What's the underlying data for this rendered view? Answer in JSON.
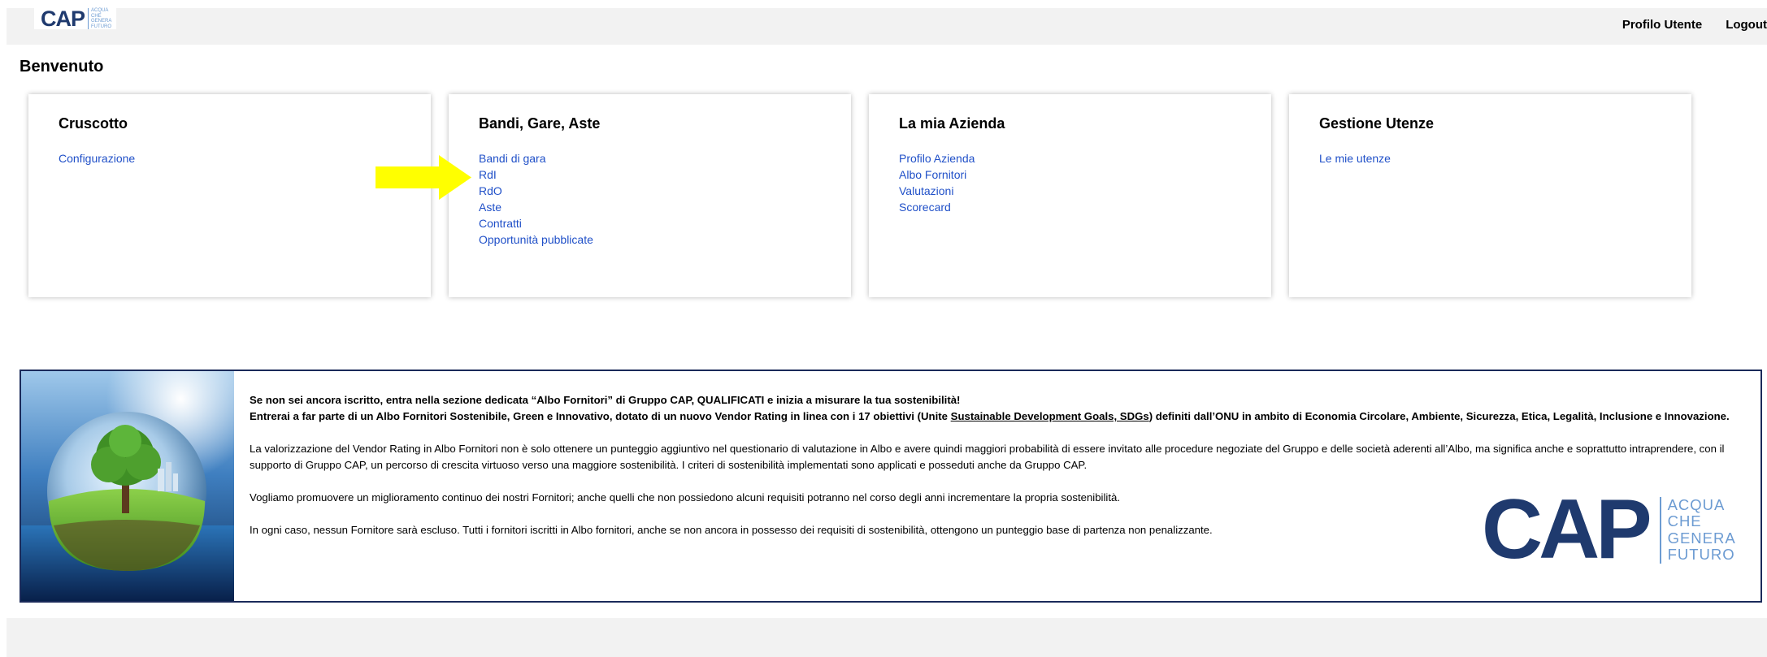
{
  "header": {
    "logo_text": "CAP",
    "logo_tagline": [
      "ACQUA",
      "CHE",
      "GENERA",
      "FUTURO"
    ],
    "profile_label": "Profilo Utente",
    "logout_label": "Logout"
  },
  "page": {
    "welcome": "Benvenuto"
  },
  "cards": [
    {
      "title": "Cruscotto",
      "links": [
        "Configurazione"
      ]
    },
    {
      "title": "Bandi, Gare, Aste",
      "links": [
        "Bandi di gara",
        "RdI",
        "RdO",
        "Aste",
        "Contratti",
        "Opportunità pubblicate"
      ]
    },
    {
      "title": "La mia Azienda",
      "links": [
        "Profilo Azienda",
        "Albo Fornitori",
        "Valutazioni",
        "Scorecard"
      ]
    },
    {
      "title": "Gestione Utenze",
      "links": [
        "Le mie utenze"
      ]
    }
  ],
  "banner": {
    "line1": "Se non sei ancora iscritto, entra nella sezione dedicata “Albo Fornitori” di Gruppo CAP, QUALIFICATI e inizia a misurare la tua sostenibilità!",
    "line2_pre": "Entrerai a far parte di un Albo Fornitori Sostenibile, Green e Innovativo, dotato di un nuovo Vendor Rating in linea con i 17 obiettivi (Unite ",
    "line2_link": "Sustainable Development Goals, SDGs",
    "line2_post": ") definiti dall’ONU in ambito di Economia Circolare, Ambiente, Sicurezza, Etica, Legalità, Inclusione e Innovazione.",
    "para2": "La valorizzazione del Vendor Rating in Albo Fornitori non è solo ottenere un punteggio aggiuntivo nel questionario di valutazione in Albo e avere quindi maggiori probabilità di essere invitato alle procedure negoziate del Gruppo e delle società aderenti all’Albo, ma significa anche e soprattutto intraprendere, con il supporto di Gruppo CAP, un percorso di crescita virtuoso verso una maggiore sostenibilità. I criteri di sostenibilità implementati sono applicati e posseduti anche da Gruppo CAP.",
    "para3": "Vogliamo promuovere un miglioramento continuo dei nostri Fornitori; anche quelli che non possiedono alcuni requisiti potranno nel corso degli anni incrementare la propria sostenibilità.",
    "para4": "In ogni caso, nessun Fornitore sarà escluso. Tutti i fornitori iscritti in Albo fornitori, anche se non ancora in possesso dei requisiti di sostenibilità, ottengono un punteggio base di partenza non penalizzante.",
    "logo_text": "CAP",
    "logo_tagline": [
      "ACQUA",
      "CHE",
      "GENERA",
      "FUTURO"
    ]
  },
  "colors": {
    "brand_navy": "#1f3a6e",
    "brand_light": "#6c9bd2",
    "link": "#2050c8",
    "arrow": "#ffff00"
  }
}
